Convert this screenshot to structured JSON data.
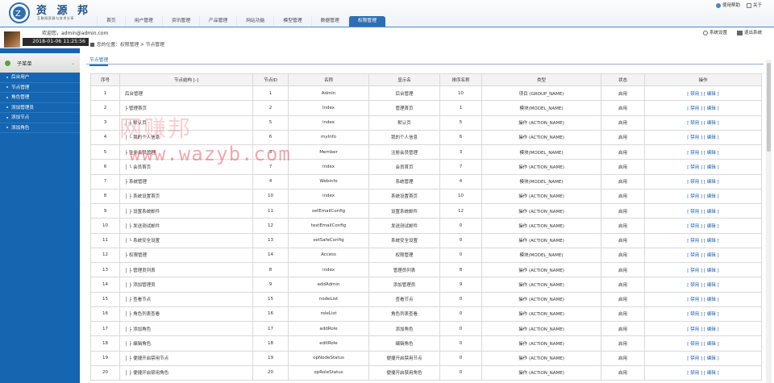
{
  "brand": {
    "name": "资 源 邦",
    "slogan": "互联网资源与技术分享"
  },
  "nav": [
    "首页",
    "用户管理",
    "资讯管理",
    "产品管理",
    "网站功能",
    "模型管理",
    "数据管理",
    "权限管理"
  ],
  "top_links": {
    "help": "使用帮助",
    "about": "关于"
  },
  "user": {
    "welcome": "欢迎您，admin@admin.com",
    "datetime": "2018-01-06 11:25:56"
  },
  "tools": {
    "settings": "系统设置",
    "logout": "退出系统"
  },
  "breadcrumb": "您的位置：权限管理 > 节点管理",
  "sidebar": {
    "title": "子菜单",
    "items": [
      "后台用户",
      "节点管理",
      "角色管理",
      "添加管理员",
      "添加节点",
      "添加角色"
    ]
  },
  "tab": "节点管理",
  "table": {
    "headers": [
      "序号",
      "节点结构 [-]",
      "节点ID",
      "名称",
      "显示名",
      "排序名称",
      "类型",
      "状态",
      "操作"
    ],
    "rows": [
      [
        "1",
        "后台管理",
        "1",
        "Admin",
        "后台管理",
        "10",
        "项目 (GROUP_NAME)",
        "启用"
      ],
      [
        "2",
        "├ 管理首页",
        "2",
        "Index",
        "管理首页",
        "1",
        "模块(MODEL_NAME)",
        "启用"
      ],
      [
        "3",
        "│ ├ 默认页",
        "5",
        "index",
        "默认页",
        "5",
        "操作 (ACTION_NAME)",
        "启用"
      ],
      [
        "4",
        "│ └ 我的个人信息",
        "6",
        "myInfo",
        "我的个人信息",
        "6",
        "操作 (ACTION_NAME)",
        "启用"
      ],
      [
        "5",
        "├ 注册会员管理",
        "3",
        "Member",
        "注册会员管理",
        "3",
        "模块(MODEL_NAME)",
        "启用"
      ],
      [
        "6",
        "│ └ 会员首页",
        "7",
        "index",
        "会员首页",
        "7",
        "操作 (ACTION_NAME)",
        "启用"
      ],
      [
        "7",
        "├ 系统管理",
        "4",
        "Webinfo",
        "系统管理",
        "4",
        "模块(MODEL_NAME)",
        "启用"
      ],
      [
        "8",
        "│ ├ 系统设置首页",
        "10",
        "index",
        "系统设置首页",
        "10",
        "操作 (ACTION_NAME)",
        "启用"
      ],
      [
        "9",
        "│ ├ 设置系统邮件",
        "11",
        "setEmailConfig",
        "设置系统邮件",
        "12",
        "操作 (ACTION_NAME)",
        "启用"
      ],
      [
        "10",
        "│ ├ 发送测试邮件",
        "12",
        "testEmailConfig",
        "发送测试邮件",
        "0",
        "操作 (ACTION_NAME)",
        "启用"
      ],
      [
        "11",
        "│ └ 系统安全设置",
        "13",
        "setSafeConfig",
        "系统安全设置",
        "0",
        "操作 (ACTION_NAME)",
        "启用"
      ],
      [
        "12",
        "├ 权限管理",
        "14",
        "Access",
        "权限管理",
        "0",
        "模块(MODEL_NAME)",
        "启用"
      ],
      [
        "13",
        "│ ├ 管理员列表",
        "8",
        "index",
        "管理员列表",
        "8",
        "操作 (ACTION_NAME)",
        "启用"
      ],
      [
        "14",
        "│ ├ 添加管理员",
        "9",
        "addAdmin",
        "添加管理员",
        "9",
        "操作 (ACTION_NAME)",
        "启用"
      ],
      [
        "15",
        "│ ├ 查看节点",
        "15",
        "nodeList",
        "查看节点",
        "0",
        "操作 (ACTION_NAME)",
        "启用"
      ],
      [
        "16",
        "│ ├ 角色列表查看",
        "16",
        "roleList",
        "角色列表查看",
        "0",
        "操作 (ACTION_NAME)",
        "启用"
      ],
      [
        "17",
        "│ ├ 添加角色",
        "17",
        "addRole",
        "添加角色",
        "0",
        "操作 (ACTION_NAME)",
        "启用"
      ],
      [
        "18",
        "│ ├ 编辑角色",
        "18",
        "editRole",
        "编辑角色",
        "0",
        "操作 (ACTION_NAME)",
        "启用"
      ],
      [
        "19",
        "│ ├ 便捷开启禁用节点",
        "19",
        "opNodeStatus",
        "便捷开启禁用节点",
        "0",
        "操作 (ACTION_NAME)",
        "启用"
      ],
      [
        "20",
        "│ ├ 便捷开启禁用角色",
        "20",
        "opRoleStatus",
        "便捷开启禁用角色",
        "0",
        "操作 (ACTION_NAME)",
        "启用"
      ]
    ],
    "op_disable": "禁用",
    "op_edit": "编辑"
  },
  "watermark": {
    "cn": "网赚邦",
    "url": "www.wazyb.com"
  }
}
